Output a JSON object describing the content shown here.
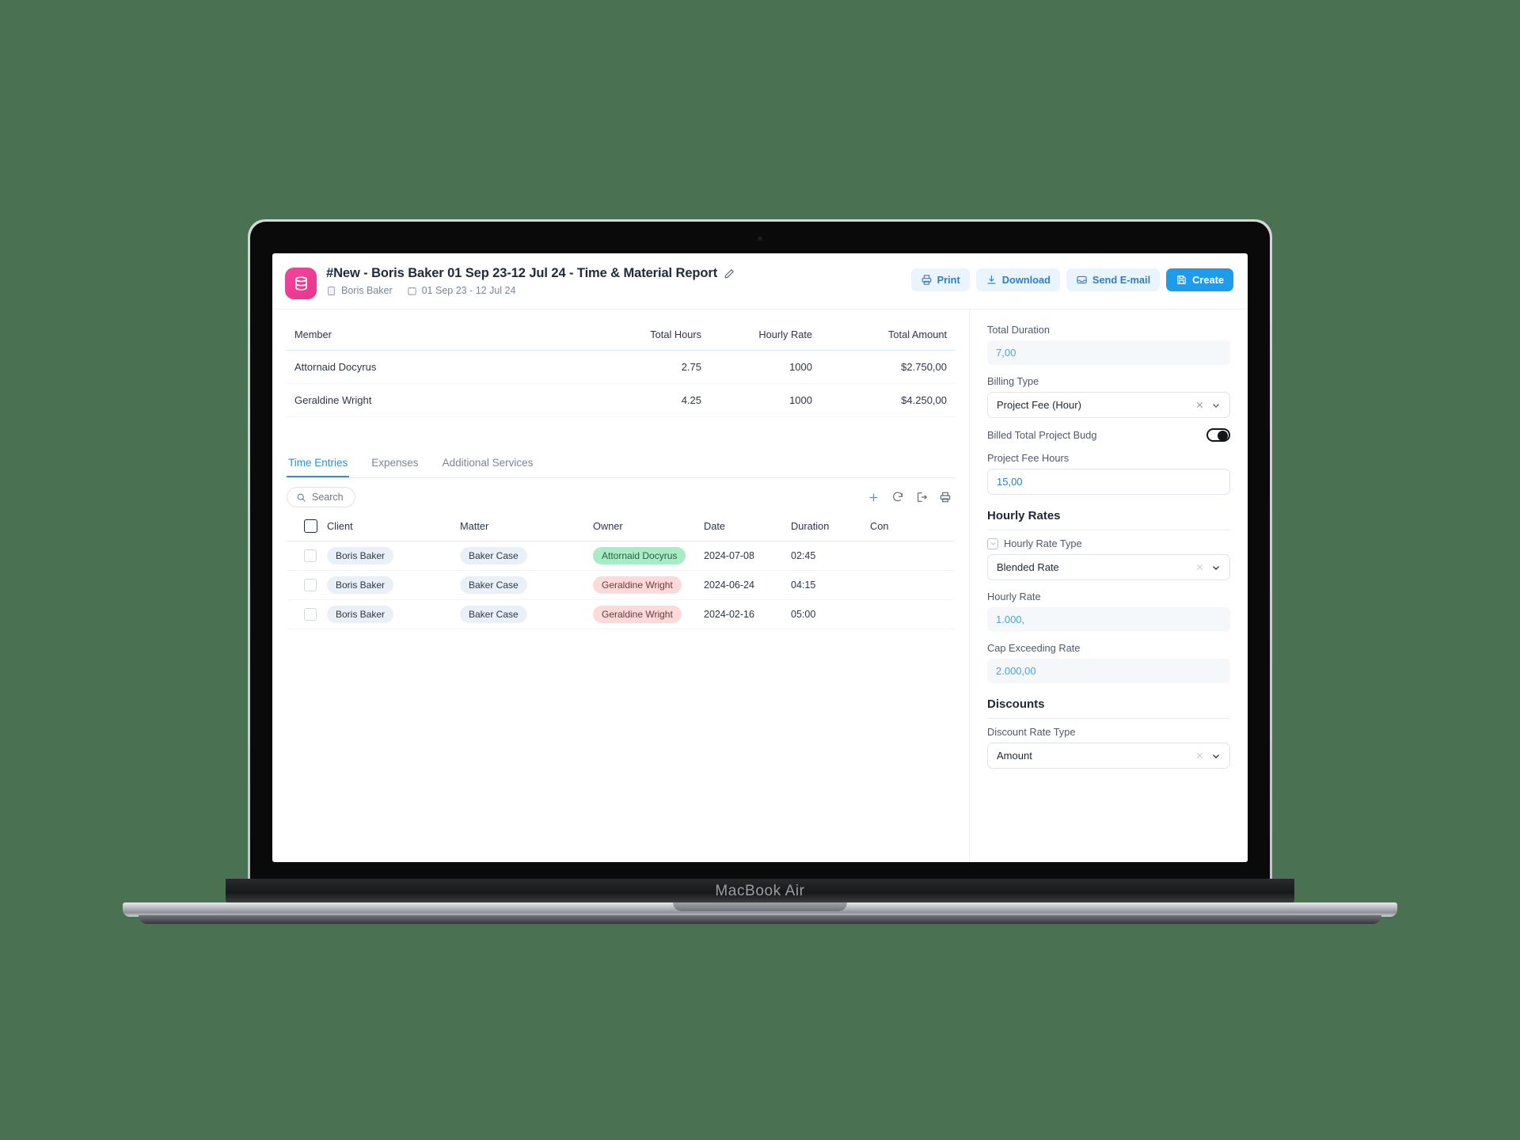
{
  "device": {
    "label": "MacBook Air"
  },
  "header": {
    "app_icon": "database-icon",
    "doc_title": "#New - Boris Baker 01 Sep 23-12 Jul 24 - Time & Material Report",
    "edit_icon": "pencil-icon",
    "client_name": "Boris Baker",
    "client_icon": "building-icon",
    "date_range": "01 Sep 23 - 12 Jul 24",
    "calendar_icon": "calendar-icon",
    "actions": [
      {
        "label": "Print",
        "icon": "printer-icon",
        "style": "ghost"
      },
      {
        "label": "Download",
        "icon": "download-icon",
        "style": "ghost"
      },
      {
        "label": "Send E-mail",
        "icon": "inbox-icon",
        "style": "ghost"
      },
      {
        "label": "Create",
        "icon": "save-icon",
        "style": "primary"
      }
    ]
  },
  "summary": {
    "columns": [
      "Member",
      "Total Hours",
      "Hourly Rate",
      "Total Amount"
    ],
    "rows": [
      {
        "member": "Attornaid Docyrus",
        "total_hours": "2.75",
        "hourly_rate": "1000",
        "total_amount": "$2.750,00"
      },
      {
        "member": "Geraldine Wright",
        "total_hours": "4.25",
        "hourly_rate": "1000",
        "total_amount": "$4.250,00"
      }
    ]
  },
  "tabs": [
    {
      "label": "Time Entries",
      "active": true
    },
    {
      "label": "Expenses",
      "active": false
    },
    {
      "label": "Additional Services",
      "active": false
    }
  ],
  "toolbar": {
    "search_label": "Search",
    "search_icon": "search-icon",
    "icons": [
      "plus-icon",
      "refresh-icon",
      "export-icon",
      "print-icon"
    ]
  },
  "entries_table": {
    "columns": [
      "Client",
      "Matter",
      "Owner",
      "Date",
      "Duration",
      "Con"
    ],
    "select_all_checkbox": false,
    "rows": [
      {
        "client": "Boris Baker",
        "matter": "Baker Case",
        "owner": "Attornaid Docyrus",
        "owner_color": "green",
        "date": "2024-07-08",
        "duration": "02:45"
      },
      {
        "client": "Boris Baker",
        "matter": "Baker Case",
        "owner": "Geraldine Wright",
        "owner_color": "pink",
        "date": "2024-06-24",
        "duration": "04:15"
      },
      {
        "client": "Boris Baker",
        "matter": "Baker Case",
        "owner": "Geraldine Wright",
        "owner_color": "pink",
        "date": "2024-02-16",
        "duration": "05:00"
      }
    ]
  },
  "sidebar": {
    "total_duration_label": "Total Duration",
    "total_duration_value": "7,00",
    "billing_type_label": "Billing Type",
    "billing_type_value": "Project Fee (Hour)",
    "billed_total_label": "Billed Total Project Budg",
    "billed_total_on": true,
    "project_fee_hours_label": "Project Fee Hours",
    "project_fee_hours_value": "15,00",
    "hourly_rates_heading": "Hourly Rates",
    "hourly_rate_type_label": "Hourly Rate Type",
    "hourly_rate_type_value": "Blended Rate",
    "hourly_rate_label": "Hourly Rate",
    "hourly_rate_value": "1.000,",
    "cap_exceeding_label": "Cap Exceeding Rate",
    "cap_exceeding_value": "2.000,00",
    "discounts_heading": "Discounts",
    "discount_rate_type_label": "Discount Rate Type",
    "discount_rate_type_value": "Amount"
  },
  "colors": {
    "brand_pink": "#ee3d93",
    "accent_blue": "#1e9ceb",
    "ghost_blue_bg": "#eaf4fd",
    "pill_green": "#a8ecc4",
    "pill_pink": "#fbdada"
  }
}
